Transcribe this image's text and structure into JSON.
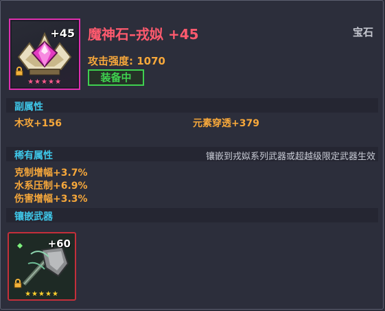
{
  "item": {
    "name": "魔神石–戎姒 +45",
    "category": "宝石",
    "attack_label": "攻击强度: 1070",
    "status_label": "装备中",
    "plus_level": "+45",
    "stars": "★★★★★",
    "icon": "gem-icon"
  },
  "sub_attributes": {
    "title": "副属性",
    "left": "木攻+156",
    "right": "元素穿透+379"
  },
  "rare_attributes": {
    "title": "稀有属性",
    "note": "镶嵌到戎姒系列武器或超越级限定武器生效",
    "items": [
      "克制增幅+3.7%",
      "水系压制+6.9%",
      "伤害增幅+3.3%"
    ]
  },
  "inlay_weapon": {
    "title": "镶嵌武器",
    "plus_level": "+60",
    "stars": "★★★★★",
    "icon": "axe-weapon-icon"
  },
  "colors": {
    "title": "#ff5a6e",
    "accent_orange": "#f7a83b",
    "section_blue": "#3fc8ea",
    "equipped_green": "#3fd14f",
    "gem_border": "#e02fb0",
    "weapon_border": "#c52f3a"
  }
}
